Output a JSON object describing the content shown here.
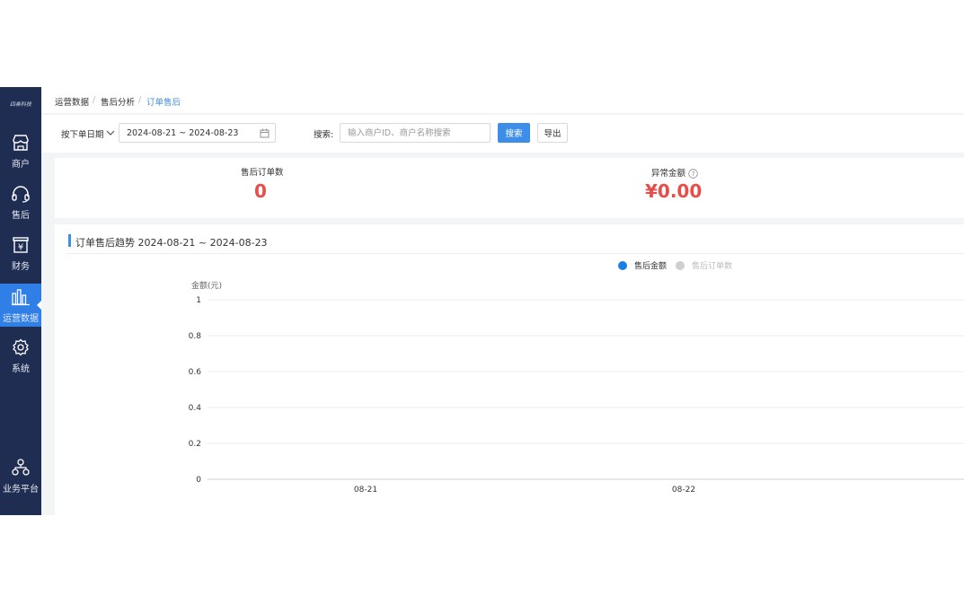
{
  "sidebar": {
    "logo": "四奏科技",
    "items": [
      {
        "label": "商户",
        "icon": "store-icon"
      },
      {
        "label": "售后",
        "icon": "headset-icon"
      },
      {
        "label": "财务",
        "icon": "finance-icon"
      },
      {
        "label": "运营数据",
        "icon": "bar-chart-icon",
        "active": true
      },
      {
        "label": "系统",
        "icon": "gear-icon"
      },
      {
        "label": "业务平台",
        "icon": "org-icon"
      }
    ]
  },
  "breadcrumb": [
    "运营数据",
    "售后分析",
    "订单售后"
  ],
  "filters": {
    "date_type": "按下单日期",
    "date_range": "2024-08-21 ~ 2024-08-23",
    "search_label": "搜索:",
    "search_placeholder": "输入商户ID、商户名称搜索",
    "search_button": "搜索",
    "export_button": "导出"
  },
  "stats": {
    "after_sale_orders_label": "售后订单数",
    "after_sale_orders_value": "0",
    "abnormal_amount_label": "异常金额",
    "abnormal_amount_value": "¥0.00"
  },
  "chart_card": {
    "title": "订单售后趋势 2024-08-21 ~ 2024-08-23"
  },
  "colors": {
    "sidebar_bg": "#1f2d52",
    "accent": "#3d8ee8",
    "value_red": "#e94d49"
  },
  "chart_data": {
    "type": "line",
    "categories": [
      "08-21",
      "08-22"
    ],
    "series": [
      {
        "name": "售后金额",
        "values": [
          0,
          0
        ],
        "color": "#1a7ee8",
        "active": true
      },
      {
        "name": "售后订单数",
        "values": [
          0,
          0
        ],
        "color": "#cfcfcf",
        "active": false
      }
    ],
    "ylabel": "金额(元)",
    "yticks": [
      "1",
      "0.8",
      "0.6",
      "0.4",
      "0.2",
      "0"
    ],
    "ylim": [
      0,
      1
    ],
    "grid": true,
    "legend": "top-center"
  }
}
